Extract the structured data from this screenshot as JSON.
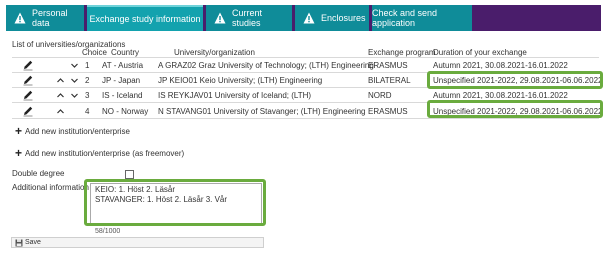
{
  "tabs": [
    {
      "label": "Personal data",
      "warning": true
    },
    {
      "label": "Exchange study information",
      "warning": false
    },
    {
      "label": "Current studies",
      "warning": true
    },
    {
      "label": "Enclosures",
      "warning": true
    },
    {
      "label": "Check and send application",
      "warning": false
    }
  ],
  "section_title": "List of universities/organizations",
  "columns": {
    "choice": "Choice",
    "country": "Country",
    "university": "University/organization",
    "program": "Exchange program",
    "duration": "Duration of your exchange"
  },
  "rows": [
    {
      "choice": "1",
      "country": "AT - Austria",
      "university": "A GRAZ02 Graz University of Technology; (LTH) Engineering",
      "program": "ERASMUS",
      "duration": "Autumn 2021, 30.08.2021-16.01.2022"
    },
    {
      "choice": "2",
      "country": "JP - Japan",
      "university": "JP KEIO01 Keio University; (LTH) Engineering",
      "program": "BILATERAL",
      "duration": "Unspecified 2021-2022, 29.08.2021-06.06.2022"
    },
    {
      "choice": "3",
      "country": "IS - Iceland",
      "university": "IS REYKJAV01 University of Iceland; (LTH)",
      "program": "NORD",
      "duration": "Autumn 2021, 30.08.2021-16.01.2022"
    },
    {
      "choice": "4",
      "country": "NO - Norway",
      "university": "N STAVANG01 University of Stavanger; (LTH) Engineering",
      "program": "ERASMUS",
      "duration": "Unspecified 2021-2022, 29.08.2021-06.06.2022"
    }
  ],
  "add_institution": "Add new institution/enterprise",
  "add_freemover": "Add new institution/enterprise (as freemover)",
  "double_degree_label": "Double degree",
  "double_degree_checked": false,
  "additional_info_label": "Additional information",
  "additional_info_value": "KEIO: 1. Höst 2. Läsår\nSTAVANGER: 1. Höst 2. Läsår 3. Vår",
  "char_counter": "58/1000",
  "save_label": "Save",
  "colors": {
    "tab_bar_bg": "#4a1d6b",
    "tab_bg": "#0f8c99",
    "tab_active_bg": "#13a2ae",
    "highlight": "#6aab3e"
  }
}
